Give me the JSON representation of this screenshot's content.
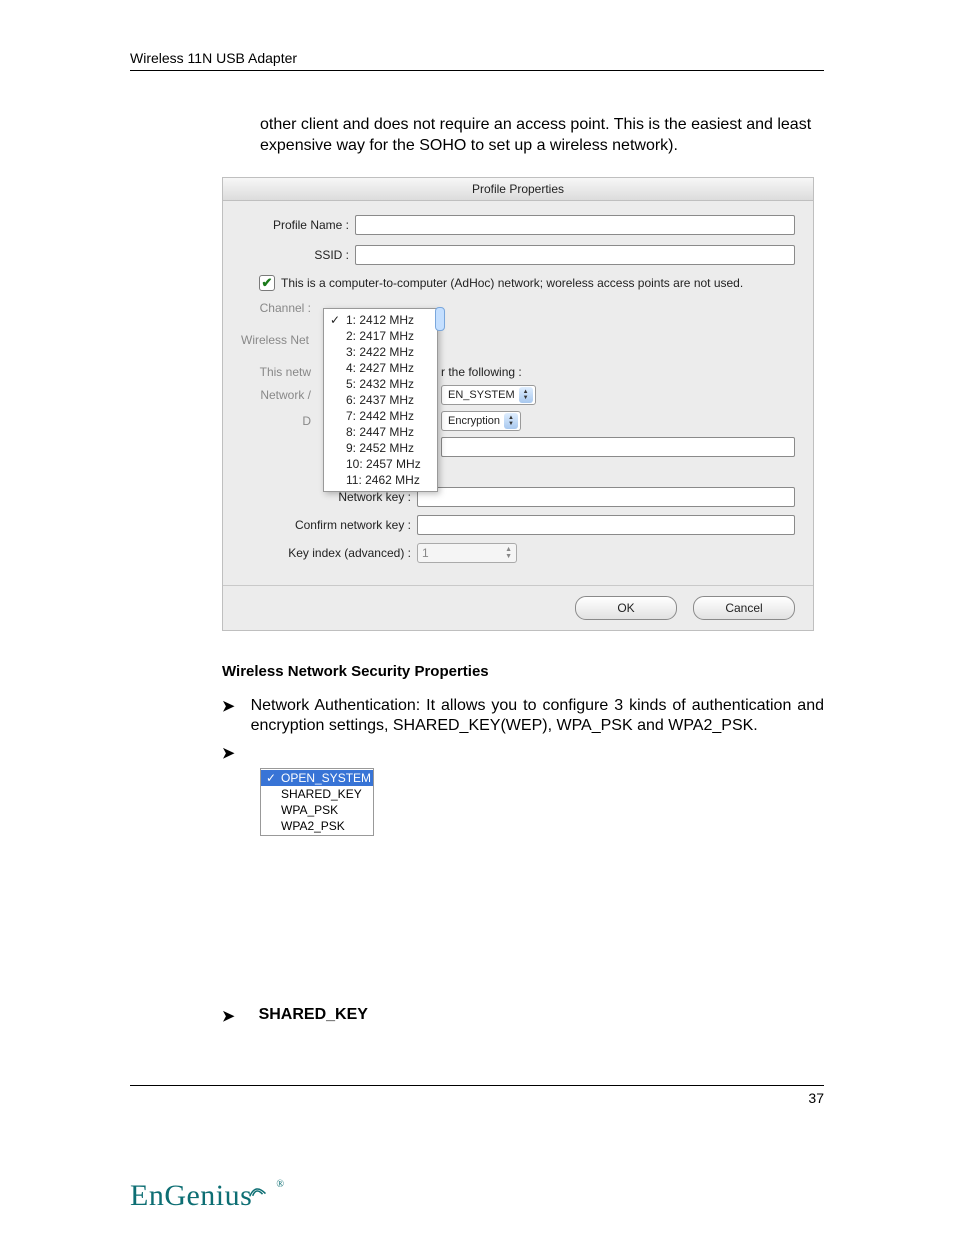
{
  "header": "Wireless 11N USB Adapter",
  "intro": "other client and does not require an access point. This is the easiest and least expensive way for the SOHO to set up a wireless network).",
  "dialog": {
    "title": "Profile Properties",
    "profileNameLabel": "Profile Name :",
    "ssidLabel": "SSID :",
    "adhocCheck": "This is a computer-to-computer (AdHoc) network; woreless access points are not used.",
    "channelLabel": "Channel :",
    "wirelessNetCut": "Wireless Net",
    "thisNetwCut": "This netw",
    "networkACut": "Network /",
    "dCut": "D",
    "followingCut": "r the following :",
    "sysSelect": "EN_SYSTEM",
    "encSelect": "Encryption",
    "networkKeyLabel": "Network key :",
    "confirmKeyLabel": "Confirm network key :",
    "keyIndexLabel": "Key index (advanced) :",
    "keyIndexValue": "1",
    "okLabel": "OK",
    "cancelLabel": "Cancel",
    "channels": [
      "1: 2412 MHz",
      "2: 2417 MHz",
      "3: 2422 MHz",
      "4: 2427 MHz",
      "5: 2432 MHz",
      "6: 2437 MHz",
      "7: 2442 MHz",
      "8: 2447 MHz",
      "9: 2452 MHz",
      "10: 2457 MHz",
      "11: 2462 MHz"
    ]
  },
  "sectionTitle": "Wireless Network Security Properties",
  "bullet1": "Network Authentication: It allows you to configure 3 kinds of authentication and encryption settings, SHARED_KEY(WEP), WPA_PSK and WPA2_PSK.",
  "authMenu": [
    "OPEN_SYSTEM",
    "SHARED_KEY",
    "WPA_PSK",
    "WPA2_PSK"
  ],
  "bullet2": "SHARED_KEY",
  "pageNumber": "37",
  "logoText": "EnGenius",
  "logoReg": "®"
}
